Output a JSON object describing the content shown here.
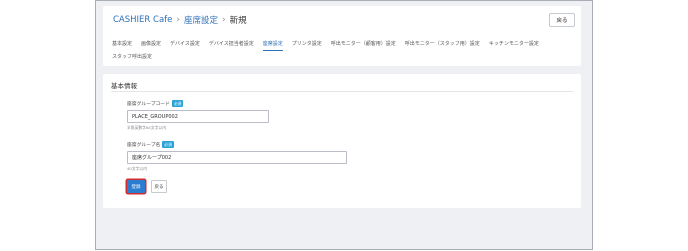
{
  "breadcrumb": {
    "app": "CASHIER Cafe",
    "section": "座席設定",
    "current": "新規"
  },
  "header": {
    "back_label": "戻る"
  },
  "tabs_row1": [
    "基本設定",
    "画像設定",
    "デバイス設定",
    "デバイス担当者設定",
    "座席設定",
    "プリンタ設定",
    "呼出モニター（顧客用）設定",
    "呼出モニター（スタッフ用）設定",
    "キッチンモニター設定"
  ],
  "tabs_row2": [
    "スタッフ呼出設定"
  ],
  "active_tab": "座席設定",
  "form": {
    "section_title": "基本情報",
    "required_badge": "必須",
    "code_label": "座席グループコード",
    "code_value": "PLACE_GROUP002",
    "code_help": "半角英数字64文字以内",
    "name_label": "座席グループ名",
    "name_value": "座席グループ002",
    "name_help": "40文字以内",
    "submit_label": "登録",
    "back_label": "戻る"
  },
  "colors": {
    "accent": "#2d6fb8",
    "badge": "#2aa3d7",
    "highlight": "#d52b2b"
  }
}
